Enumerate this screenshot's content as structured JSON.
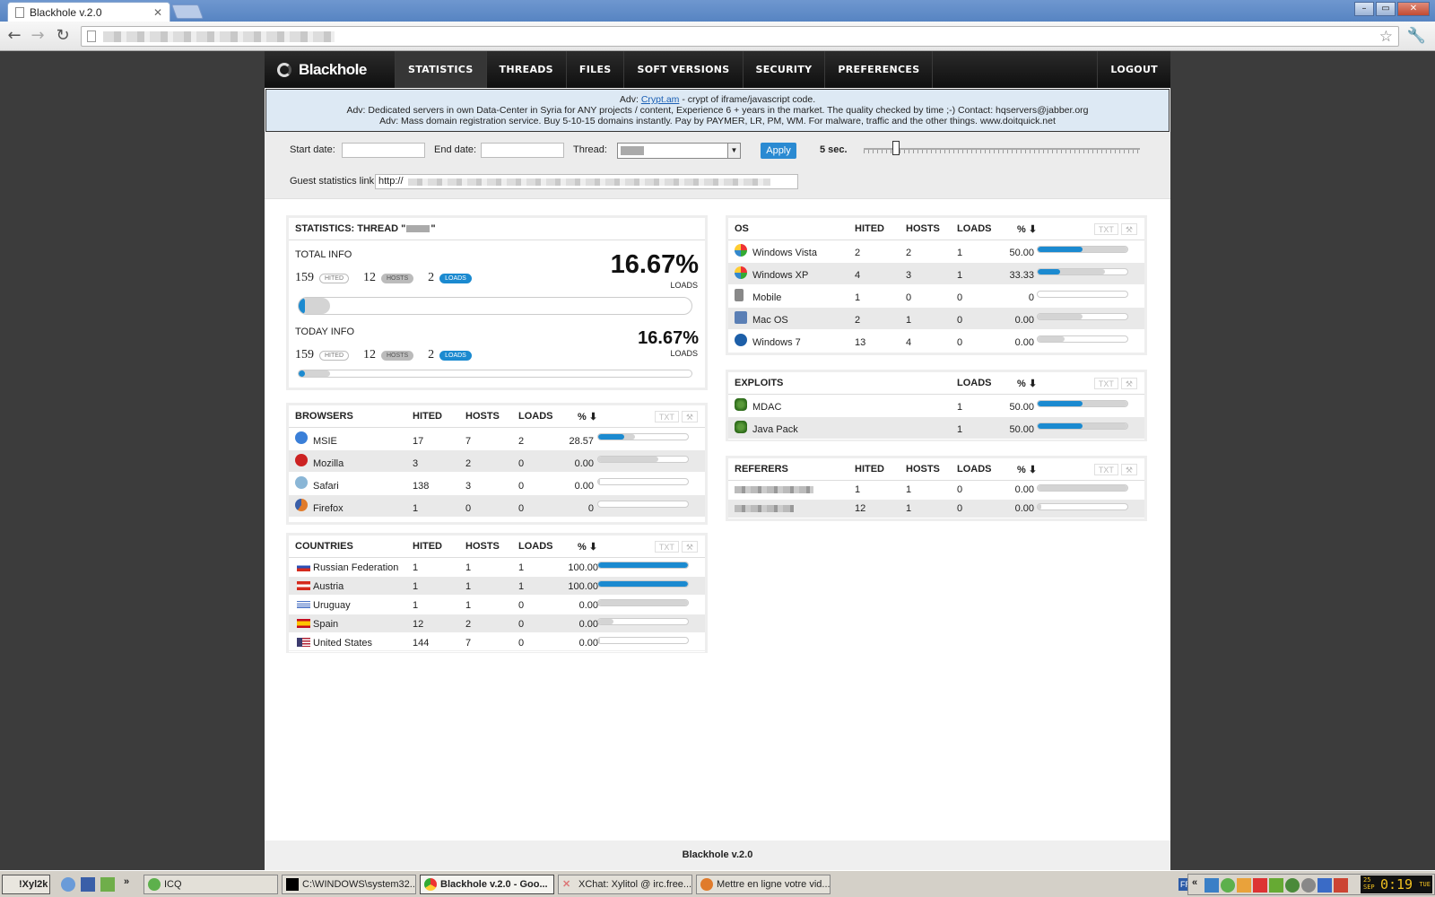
{
  "browser": {
    "tab_title": "Blackhole v.2.0",
    "tab_close": "✕",
    "back": "←",
    "forward": "→",
    "reload": "↻",
    "star": "☆",
    "wrench": "🔧",
    "win_min": "–",
    "win_max": "▭",
    "win_close": "✕"
  },
  "nav": {
    "logo": "Blackhole",
    "items": [
      "STATISTICS",
      "THREADS",
      "FILES",
      "SOFT VERSIONS",
      "SECURITY",
      "PREFERENCES"
    ],
    "logout": "LOGOUT"
  },
  "adv": {
    "line1_prefix": "Adv: ",
    "line1_link": "Crypt.am",
    "line1_suffix": " - crypt of iframe/javascript code.",
    "line2": "Adv: Dedicated servers in own Data-Center in Syria for ANY projects / content, Experience 6 + years in the market. The quality checked by time ;-) Contact: hqservers@jabber.org",
    "line3": "Adv: Mass domain registration service. Buy 5-10-15 domains instantly. Pay by PAYMER, LR, PM, WM. For malware, traffic and the other things. www.doitquick.net"
  },
  "filters": {
    "start_date_label": "Start date:",
    "end_date_label": "End date:",
    "thread_label": "Thread:",
    "apply": "Apply",
    "refresh": "5 sec.",
    "guest_label": "Guest statistics link:",
    "guest_value": "http://"
  },
  "stats": {
    "title": "STATISTICS: THREAD \"",
    "title_end": "\"",
    "total": {
      "label": "TOTAL INFO",
      "hited": "159",
      "hosts": "12",
      "loads": "2",
      "pct": "16.67%",
      "pct_label": "LOADS",
      "fraction": 0.1667
    },
    "today": {
      "label": "TODAY INFO",
      "hited": "159",
      "hosts": "12",
      "loads": "2",
      "pct": "16.67%",
      "pct_label": "LOADS",
      "fraction": 0.1667
    },
    "pill_hited": "HITED",
    "pill_hosts": "HOSTS",
    "pill_loads": "LOADS"
  },
  "columns": {
    "hited": "HITED",
    "hosts": "HOSTS",
    "loads": "LOADS",
    "pct": "% ⬇",
    "txt": "TXT",
    "tool": "⚒"
  },
  "browsers": {
    "title": "BROWSERS",
    "rows": [
      {
        "name": "MSIE",
        "hited": "17",
        "hosts": "7",
        "loads": "2",
        "pct": "28.57",
        "fill": 0.2857,
        "gray": 0.41
      },
      {
        "name": "Mozilla",
        "hited": "3",
        "hosts": "2",
        "loads": "0",
        "pct": "0.00",
        "fill": 0,
        "gray": 0.67
      },
      {
        "name": "Safari",
        "hited": "138",
        "hosts": "3",
        "loads": "0",
        "pct": "0.00",
        "fill": 0,
        "gray": 0.02
      },
      {
        "name": "Firefox",
        "hited": "1",
        "hosts": "0",
        "loads": "0",
        "pct": "0",
        "fill": 0,
        "gray": 0
      }
    ]
  },
  "countries": {
    "title": "COUNTRIES",
    "rows": [
      {
        "name": "Russian Federation",
        "hited": "1",
        "hosts": "1",
        "loads": "1",
        "pct": "100.00",
        "fill": 1.0,
        "gray": 1.0
      },
      {
        "name": "Austria",
        "hited": "1",
        "hosts": "1",
        "loads": "1",
        "pct": "100.00",
        "fill": 1.0,
        "gray": 1.0
      },
      {
        "name": "Uruguay",
        "hited": "1",
        "hosts": "1",
        "loads": "0",
        "pct": "0.00",
        "fill": 0,
        "gray": 1.0
      },
      {
        "name": "Spain",
        "hited": "12",
        "hosts": "2",
        "loads": "0",
        "pct": "0.00",
        "fill": 0,
        "gray": 0.17
      },
      {
        "name": "United States",
        "hited": "144",
        "hosts": "7",
        "loads": "0",
        "pct": "0.00",
        "fill": 0,
        "gray": 0.02
      }
    ]
  },
  "os": {
    "title": "OS",
    "rows": [
      {
        "name": "Windows Vista",
        "hited": "2",
        "hosts": "2",
        "loads": "1",
        "pct": "50.00",
        "fill": 0.5,
        "gray": 1.0
      },
      {
        "name": "Windows XP",
        "hited": "4",
        "hosts": "3",
        "loads": "1",
        "pct": "33.33",
        "fill": 0.25,
        "gray": 0.75
      },
      {
        "name": "Mobile",
        "hited": "1",
        "hosts": "0",
        "loads": "0",
        "pct": "0",
        "fill": 0,
        "gray": 0
      },
      {
        "name": "Mac OS",
        "hited": "2",
        "hosts": "1",
        "loads": "0",
        "pct": "0.00",
        "fill": 0,
        "gray": 0.5
      },
      {
        "name": "Windows 7",
        "hited": "13",
        "hosts": "4",
        "loads": "0",
        "pct": "0.00",
        "fill": 0,
        "gray": 0.3
      }
    ]
  },
  "exploits": {
    "title": "EXPLOITS",
    "rows": [
      {
        "name": "MDAC",
        "loads": "1",
        "pct": "50.00",
        "fill": 0.5,
        "gray": 1.0
      },
      {
        "name": "Java Pack",
        "loads": "1",
        "pct": "50.00",
        "fill": 0.5,
        "gray": 1.0
      }
    ]
  },
  "referers": {
    "title": "REFERERS",
    "rows": [
      {
        "hited": "1",
        "hosts": "1",
        "loads": "0",
        "pct": "0.00",
        "fill": 0,
        "gray": 1.0
      },
      {
        "hited": "12",
        "hosts": "1",
        "loads": "0",
        "pct": "0.00",
        "fill": 0,
        "gray": 0.04
      }
    ]
  },
  "footer": "Blackhole v.2.0",
  "taskbar": {
    "start": "!Xyl2k",
    "chevron": "»",
    "tray_chevron": "«",
    "lang": "FR",
    "windows": [
      "ICQ",
      "C:\\WINDOWS\\system32...",
      "Blackhole v.2.0 - Goo...",
      "XChat: Xylitol @ irc.free...",
      "Mettre en ligne votre vid..."
    ],
    "clock": "0:19",
    "date_day": "25",
    "date_mon": "SEP",
    "weekday": "TUE"
  }
}
